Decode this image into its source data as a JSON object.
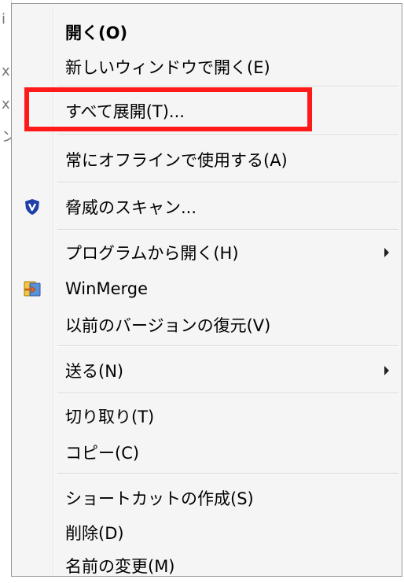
{
  "background_window": {
    "fragments": [
      "i",
      "x",
      "x",
      "ン"
    ]
  },
  "context_menu": {
    "items": [
      {
        "label": "開く(O)",
        "bold": true
      },
      {
        "label": "新しいウィンドウで開く(E)"
      },
      {
        "label": "すべて展開(T)..."
      },
      {
        "label": "常にオフラインで使用する(A)"
      },
      {
        "label": "脅威のスキャン...",
        "icon": "shield-icon"
      },
      {
        "label": "プログラムから開く(H)",
        "submenu": true
      },
      {
        "label": "WinMerge",
        "icon": "winmerge-icon"
      },
      {
        "label": "以前のバージョンの復元(V)"
      },
      {
        "label": "送る(N)",
        "submenu": true
      },
      {
        "label": "切り取り(T)"
      },
      {
        "label": "コピー(C)"
      },
      {
        "label": "ショートカットの作成(S)"
      },
      {
        "label": "削除(D)"
      },
      {
        "label": "名前の変更(M)"
      }
    ]
  },
  "annotation": {
    "highlight_color": "#ff1a1a",
    "highlighted_item": "すべて展開(T)..."
  },
  "colors": {
    "menu_background": "#f5f5f5",
    "menu_border": "#979797",
    "separator": "#d7d7d7",
    "shield_blue": "#1f3fa8"
  }
}
